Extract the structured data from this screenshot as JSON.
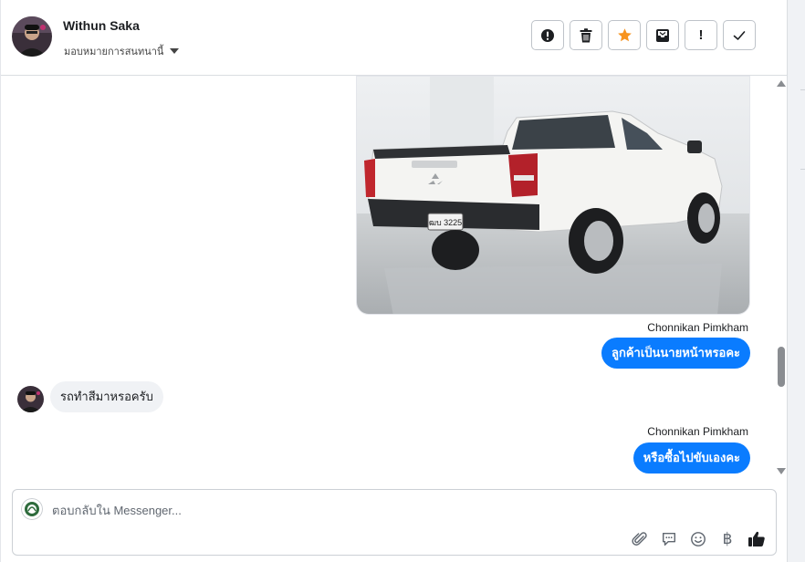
{
  "header": {
    "contact_name": "Withun Saka",
    "assign_label": "มอบหมายการสนทนานี้",
    "toolbar": [
      {
        "name": "spam-button",
        "icon": "alert-circle-icon"
      },
      {
        "name": "delete-button",
        "icon": "trash-icon"
      },
      {
        "name": "star-button",
        "icon": "star-icon",
        "color": "#f7931e"
      },
      {
        "name": "archive-button",
        "icon": "inbox-icon"
      },
      {
        "name": "mark-important-button",
        "icon": "exclamation-icon",
        "glyph": "!"
      },
      {
        "name": "mark-done-button",
        "icon": "check-icon"
      }
    ]
  },
  "conversation": {
    "photo_plate": "ฒบ 3225",
    "messages": [
      {
        "sender": "Chonnikan Pimkham",
        "text": "ลูกค้าเป็นนายหน้าหรอคะ",
        "direction": "outgoing"
      },
      {
        "text": "รถทำสีมาหรอครับ",
        "direction": "incoming"
      },
      {
        "sender": "Chonnikan Pimkham",
        "text": "หรือซื้อไปขับเองคะ",
        "direction": "outgoing"
      }
    ]
  },
  "composer": {
    "placeholder": "ตอบกลับใน Messenger...",
    "currency_glyph": "฿",
    "tools": [
      "paperclip-icon",
      "saved-reply-icon",
      "emoji-icon",
      "currency-icon",
      "thumbs-up-icon"
    ]
  },
  "colors": {
    "accent": "#0a7cff",
    "star": "#f7931e",
    "incoming_bubble": "#f0f2f5"
  }
}
